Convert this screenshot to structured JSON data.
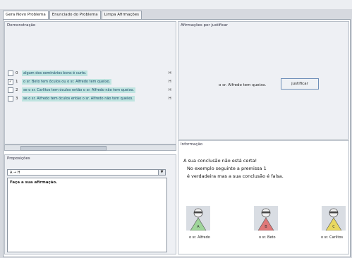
{
  "tabs": [
    "Gera Novo Problema",
    "Enunciado do Problema",
    "Limpa Afirmações"
  ],
  "demonstracao": {
    "title": "Demonstração",
    "rows": [
      {
        "checked": false,
        "num": "0",
        "text": "algum dos seminários bons é curto.",
        "mark": "H"
      },
      {
        "checked": true,
        "num": "1",
        "text": "o sr. Beto tem óculos ou o sr. Alfredo tem queixo.",
        "mark": "H"
      },
      {
        "checked": false,
        "num": "2",
        "text": "se o sr. Carlitos tem óculos então o sr. Alfredo não tem queixo.",
        "mark": "H"
      },
      {
        "checked": false,
        "num": "3",
        "text": "se o sr. Alfredo tem óculos então o sr. Alfredo não tem queixo.",
        "mark": "H"
      }
    ]
  },
  "proposicoes": {
    "title": "Proposições",
    "select_value": "A → H",
    "textarea_text": "Faça a sua afirmação."
  },
  "afirmacoes": {
    "title": "Afirmações por justificar",
    "text": "o sr. Alfredo tem queixo.",
    "button": "justificar"
  },
  "informacao": {
    "title": "Informação",
    "line1": "A sua conclusão não está certa!",
    "line2": "No exemplo seguinte a premissa 1",
    "line3": "é verdadeira mas a sua conclusão é falsa."
  },
  "characters": [
    {
      "name": "o sr. Alfredo",
      "color": "#9fd59a"
    },
    {
      "name": "o sr. Beto",
      "color": "#e07878"
    },
    {
      "name": "o sr. Carlitos",
      "color": "#e9d860"
    }
  ]
}
